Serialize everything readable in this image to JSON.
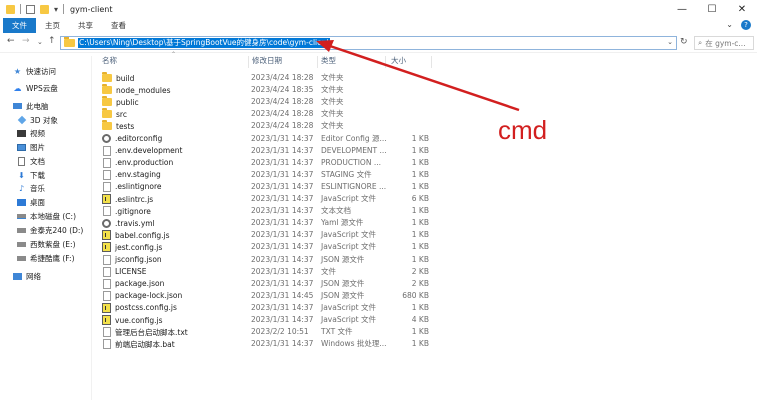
{
  "window": {
    "title": "gym-client",
    "controls": [
      "—",
      "☐",
      "✕"
    ]
  },
  "ribbon": {
    "tabs": [
      "文件",
      "主页",
      "共享",
      "查看"
    ]
  },
  "address": {
    "path": "C:\\Users\\Ning\\Desktop\\基于SpringBootVue的健身房\\code\\gym-client",
    "search_placeholder": "在 gym-c..."
  },
  "sidebar": {
    "items": [
      {
        "label": "快速访问",
        "icon": "star-icon"
      },
      {
        "label": "WPS云盘",
        "icon": "cloud-icon"
      },
      {
        "label": "此电脑",
        "icon": "computer-icon"
      },
      {
        "label": "3D 对象",
        "icon": "cube-icon"
      },
      {
        "label": "视频",
        "icon": "video-icon"
      },
      {
        "label": "图片",
        "icon": "picture-icon"
      },
      {
        "label": "文档",
        "icon": "document-icon"
      },
      {
        "label": "下载",
        "icon": "download-icon"
      },
      {
        "label": "音乐",
        "icon": "music-icon"
      },
      {
        "label": "桌面",
        "icon": "desktop-icon"
      },
      {
        "label": "本地磁盘 (C:)",
        "icon": "drive-icon"
      },
      {
        "label": "金泰克240 (D:)",
        "icon": "drive-icon"
      },
      {
        "label": "西数紫盘 (E:)",
        "icon": "drive-icon"
      },
      {
        "label": "希捷酷鹰 (F:)",
        "icon": "drive-icon"
      },
      {
        "label": "网络",
        "icon": "network-icon"
      }
    ]
  },
  "columns": {
    "name": "名称",
    "date": "修改日期",
    "type": "类型",
    "size": "大小"
  },
  "files": [
    {
      "name": "build",
      "date": "2023/4/24 18:28",
      "type": "文件夹",
      "size": "",
      "icon": "folder-icon"
    },
    {
      "name": "node_modules",
      "date": "2023/4/24 18:35",
      "type": "文件夹",
      "size": "",
      "icon": "folder-icon"
    },
    {
      "name": "public",
      "date": "2023/4/24 18:28",
      "type": "文件夹",
      "size": "",
      "icon": "folder-icon"
    },
    {
      "name": "src",
      "date": "2023/4/24 18:28",
      "type": "文件夹",
      "size": "",
      "icon": "folder-icon"
    },
    {
      "name": "tests",
      "date": "2023/4/24 18:28",
      "type": "文件夹",
      "size": "",
      "icon": "folder-icon"
    },
    {
      "name": ".editorconfig",
      "date": "2023/1/31 14:37",
      "type": "Editor Config 源...",
      "size": "1 KB",
      "icon": "gear-icon"
    },
    {
      "name": ".env.development",
      "date": "2023/1/31 14:37",
      "type": "DEVELOPMENT ...",
      "size": "1 KB",
      "icon": "file-icon"
    },
    {
      "name": ".env.production",
      "date": "2023/1/31 14:37",
      "type": "PRODUCTION ...",
      "size": "1 KB",
      "icon": "file-icon"
    },
    {
      "name": ".env.staging",
      "date": "2023/1/31 14:37",
      "type": "STAGING 文件",
      "size": "1 KB",
      "icon": "file-icon"
    },
    {
      "name": ".eslintignore",
      "date": "2023/1/31 14:37",
      "type": "ESLINTIGNORE ...",
      "size": "1 KB",
      "icon": "file-icon"
    },
    {
      "name": ".eslintrc.js",
      "date": "2023/1/31 14:37",
      "type": "JavaScript 文件",
      "size": "6 KB",
      "icon": "js-icon"
    },
    {
      "name": ".gitignore",
      "date": "2023/1/31 14:37",
      "type": "文本文档",
      "size": "1 KB",
      "icon": "file-icon"
    },
    {
      "name": ".travis.yml",
      "date": "2023/1/31 14:37",
      "type": "Yaml 源文件",
      "size": "1 KB",
      "icon": "gear-icon"
    },
    {
      "name": "babel.config.js",
      "date": "2023/1/31 14:37",
      "type": "JavaScript 文件",
      "size": "1 KB",
      "icon": "js-icon"
    },
    {
      "name": "jest.config.js",
      "date": "2023/1/31 14:37",
      "type": "JavaScript 文件",
      "size": "1 KB",
      "icon": "js-icon"
    },
    {
      "name": "jsconfig.json",
      "date": "2023/1/31 14:37",
      "type": "JSON 源文件",
      "size": "1 KB",
      "icon": "file-icon"
    },
    {
      "name": "LICENSE",
      "date": "2023/1/31 14:37",
      "type": "文件",
      "size": "2 KB",
      "icon": "file-icon"
    },
    {
      "name": "package.json",
      "date": "2023/1/31 14:37",
      "type": "JSON 源文件",
      "size": "2 KB",
      "icon": "file-icon"
    },
    {
      "name": "package-lock.json",
      "date": "2023/1/31 14:45",
      "type": "JSON 源文件",
      "size": "680 KB",
      "icon": "file-icon"
    },
    {
      "name": "postcss.config.js",
      "date": "2023/1/31 14:37",
      "type": "JavaScript 文件",
      "size": "1 KB",
      "icon": "js-icon"
    },
    {
      "name": "vue.config.js",
      "date": "2023/1/31 14:37",
      "type": "JavaScript 文件",
      "size": "4 KB",
      "icon": "js-icon"
    },
    {
      "name": "管理后台启动脚本.txt",
      "date": "2023/2/2 10:51",
      "type": "TXT 文件",
      "size": "1 KB",
      "icon": "file-icon"
    },
    {
      "name": "前端启动脚本.bat",
      "date": "2023/1/31 14:37",
      "type": "Windows 批处理...",
      "size": "1 KB",
      "icon": "file-icon"
    }
  ],
  "annotation": {
    "text": "cmd",
    "color": "#d21f1f"
  }
}
